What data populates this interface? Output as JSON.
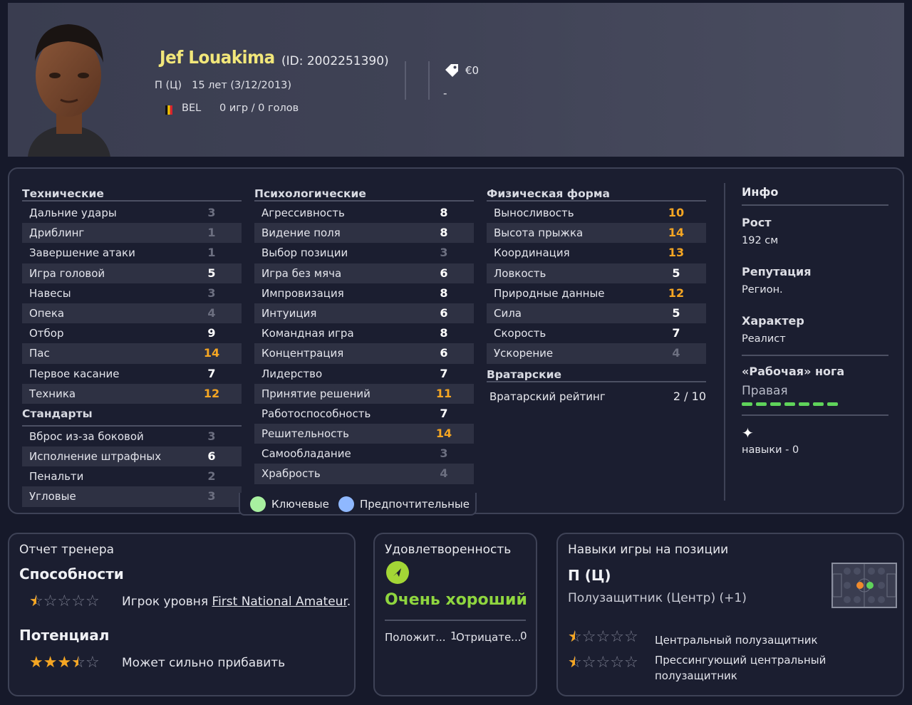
{
  "player": {
    "name": "Jef Louakima",
    "id_text": "(ID: 2002251390)",
    "position": "П (Ц)",
    "age_text": "15 лет (3/12/2013)",
    "nation": "BEL",
    "games_text": "0 игр / 0 голов",
    "value": "€0",
    "contract": "-"
  },
  "technical": {
    "title": "Технические",
    "rows": [
      {
        "label": "Дальние удары",
        "value": "3"
      },
      {
        "label": "Дриблинг",
        "value": "1"
      },
      {
        "label": "Завершение атаки",
        "value": "1"
      },
      {
        "label": "Игра головой",
        "value": "5"
      },
      {
        "label": "Навесы",
        "value": "3"
      },
      {
        "label": "Опека",
        "value": "4"
      },
      {
        "label": "Отбор",
        "value": "9"
      },
      {
        "label": "Пас",
        "value": "14"
      },
      {
        "label": "Первое касание",
        "value": "7"
      },
      {
        "label": "Техника",
        "value": "12"
      }
    ]
  },
  "set_pieces": {
    "title": "Стандарты",
    "rows": [
      {
        "label": "Вброс из-за боковой",
        "value": "3"
      },
      {
        "label": "Исполнение штрафных",
        "value": "6"
      },
      {
        "label": "Пенальти",
        "value": "2"
      },
      {
        "label": "Угловые",
        "value": "3"
      }
    ]
  },
  "mental": {
    "title": "Психологические",
    "rows": [
      {
        "label": "Агрессивность",
        "value": "8"
      },
      {
        "label": "Видение поля",
        "value": "8"
      },
      {
        "label": "Выбор позиции",
        "value": "3"
      },
      {
        "label": "Игра без мяча",
        "value": "6"
      },
      {
        "label": "Импровизация",
        "value": "8"
      },
      {
        "label": "Интуиция",
        "value": "6"
      },
      {
        "label": "Командная игра",
        "value": "8"
      },
      {
        "label": "Концентрация",
        "value": "6"
      },
      {
        "label": "Лидерство",
        "value": "7"
      },
      {
        "label": "Принятие решений",
        "value": "11"
      },
      {
        "label": "Работоспособность",
        "value": "7"
      },
      {
        "label": "Решительность",
        "value": "14"
      },
      {
        "label": "Самообладание",
        "value": "3"
      },
      {
        "label": "Храбрость",
        "value": "4"
      }
    ]
  },
  "physical": {
    "title": "Физическая форма",
    "rows": [
      {
        "label": "Выносливость",
        "value": "10"
      },
      {
        "label": "Высота прыжка",
        "value": "14"
      },
      {
        "label": "Координация",
        "value": "13"
      },
      {
        "label": "Ловкость",
        "value": "5"
      },
      {
        "label": "Природные данные",
        "value": "12"
      },
      {
        "label": "Сила",
        "value": "5"
      },
      {
        "label": "Скорость",
        "value": "7"
      },
      {
        "label": "Ускорение",
        "value": "4"
      }
    ]
  },
  "goalkeeping": {
    "title": "Вратарские",
    "label": "Вратарский рейтинг",
    "value": "2 / 10"
  },
  "info": {
    "title": "Инфо",
    "height_label": "Рост",
    "height": "192 см",
    "reputation_label": "Репутация",
    "reputation": "Регион.",
    "personality_label": "Характер",
    "personality": "Реалист",
    "foot_label": "«Рабочая» нога",
    "foot": "Правая",
    "skills": "навыки - 0"
  },
  "legend": {
    "key": "Ключевые",
    "preferred": "Предпочтительные",
    "key_color": "#a8f0a0",
    "preferred_color": "#8fb8ff"
  },
  "coach": {
    "title": "Отчет тренера",
    "ability_label": "Способности",
    "ability_stars": 0.5,
    "ability_text_prefix": "Игрок уровня ",
    "ability_link": "First National Amateur",
    "ability_text_suffix": ".",
    "potential_label": "Потенциал",
    "potential_stars": 3.5,
    "potential_text": "Может сильно прибавить"
  },
  "satisfaction": {
    "title": "Удовлетворенность",
    "value": "Очень хороший",
    "positive_label": "Положит...",
    "positive_count": "1",
    "negative_label": "Отрицате...",
    "negative_count": "0"
  },
  "positions": {
    "title": "Навыки игры на позиции",
    "short": "П (Ц)",
    "full": "Полузащитник (Центр) (+1)",
    "roles": [
      {
        "name": "Центральный полузащитник",
        "stars": 0.5
      },
      {
        "name": "Прессингующий центральный полузащитник",
        "stars": 0.5
      }
    ]
  },
  "colors": {
    "accent_name": "#f2e77a",
    "high_attr": "#f5a623",
    "low_attr": "#6c6f80",
    "satisfaction": "#8fd63f"
  }
}
